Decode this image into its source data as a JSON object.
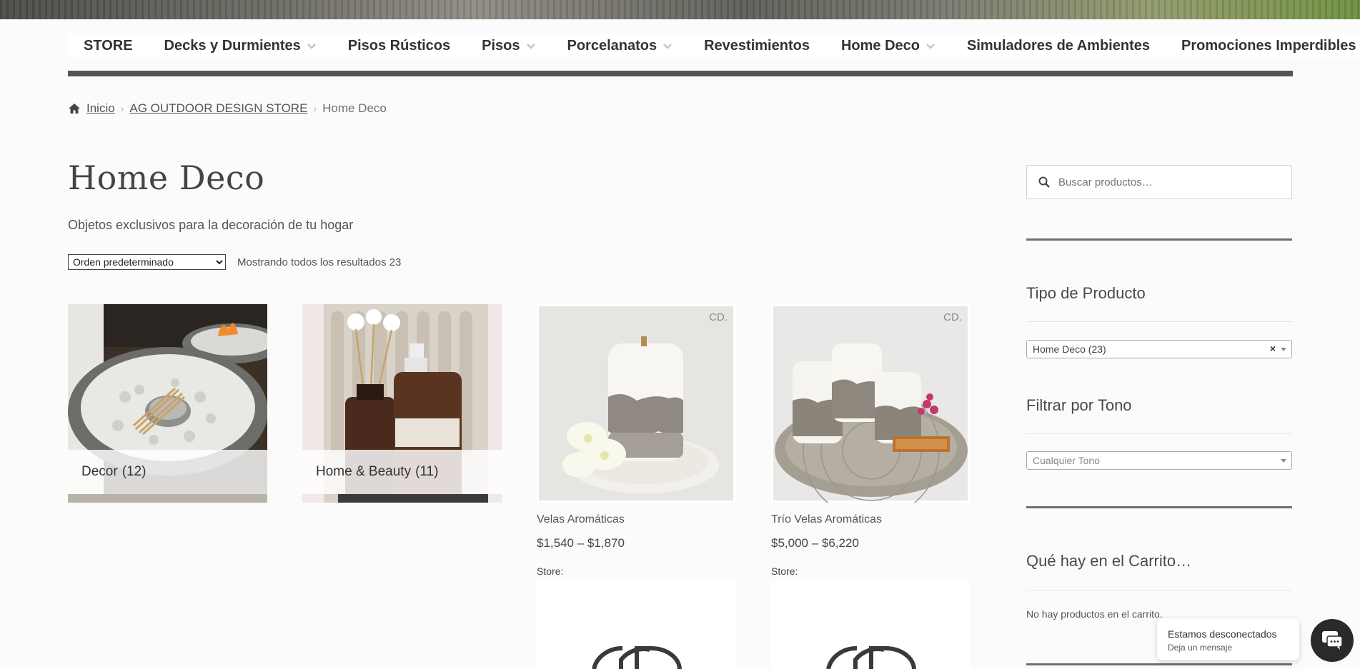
{
  "nav": {
    "items": [
      {
        "label": "STORE",
        "dropdown": false
      },
      {
        "label": "Decks y Durmientes",
        "dropdown": true
      },
      {
        "label": "Pisos Rústicos",
        "dropdown": false
      },
      {
        "label": "Pisos",
        "dropdown": true
      },
      {
        "label": "Porcelanatos",
        "dropdown": true
      },
      {
        "label": "Revestimientos",
        "dropdown": false
      },
      {
        "label": "Home Deco",
        "dropdown": true
      },
      {
        "label": "Simuladores de Ambientes",
        "dropdown": false
      },
      {
        "label": "Promociones Imperdibles",
        "dropdown": false
      }
    ]
  },
  "breadcrumb": {
    "home": "Inicio",
    "store": "AG OUTDOOR DESIGN STORE",
    "current": "Home Deco"
  },
  "page": {
    "title": "Home Deco",
    "description": "Objetos exclusivos para la decoración de tu hogar",
    "sort_selected": "Orden predeterminado",
    "result_count": "Mostrando todos los resultados 23"
  },
  "categories": [
    {
      "name": "Decor",
      "count": "(12)"
    },
    {
      "name": "Home & Beauty",
      "count": "(11)"
    }
  ],
  "products": [
    {
      "name": "Velas Aromáticas",
      "price": "$1,540 – $1,870",
      "store_label": "Store:",
      "watermark": "CD."
    },
    {
      "name": "Trío Velas Aromáticas",
      "price": "$5,000 – $6,220",
      "store_label": "Store:",
      "watermark": "CD."
    }
  ],
  "sidebar": {
    "search_placeholder": "Buscar productos…",
    "product_type_title": "Tipo de Producto",
    "product_type_value": "Home Deco  (23)",
    "product_type_clear": "×",
    "tone_title": "Filtrar por Tono",
    "tone_value": "Cualquier Tono",
    "cart_title": "Qué hay en el Carrito…",
    "cart_empty": "No hay productos en el carrito."
  },
  "chat": {
    "status": "Estamos desconectados",
    "action": "Deja un mensaje"
  },
  "colors": {
    "nav_bar": "#555555",
    "background": "#fbfbfb",
    "chat_button": "#2a2a2a"
  }
}
